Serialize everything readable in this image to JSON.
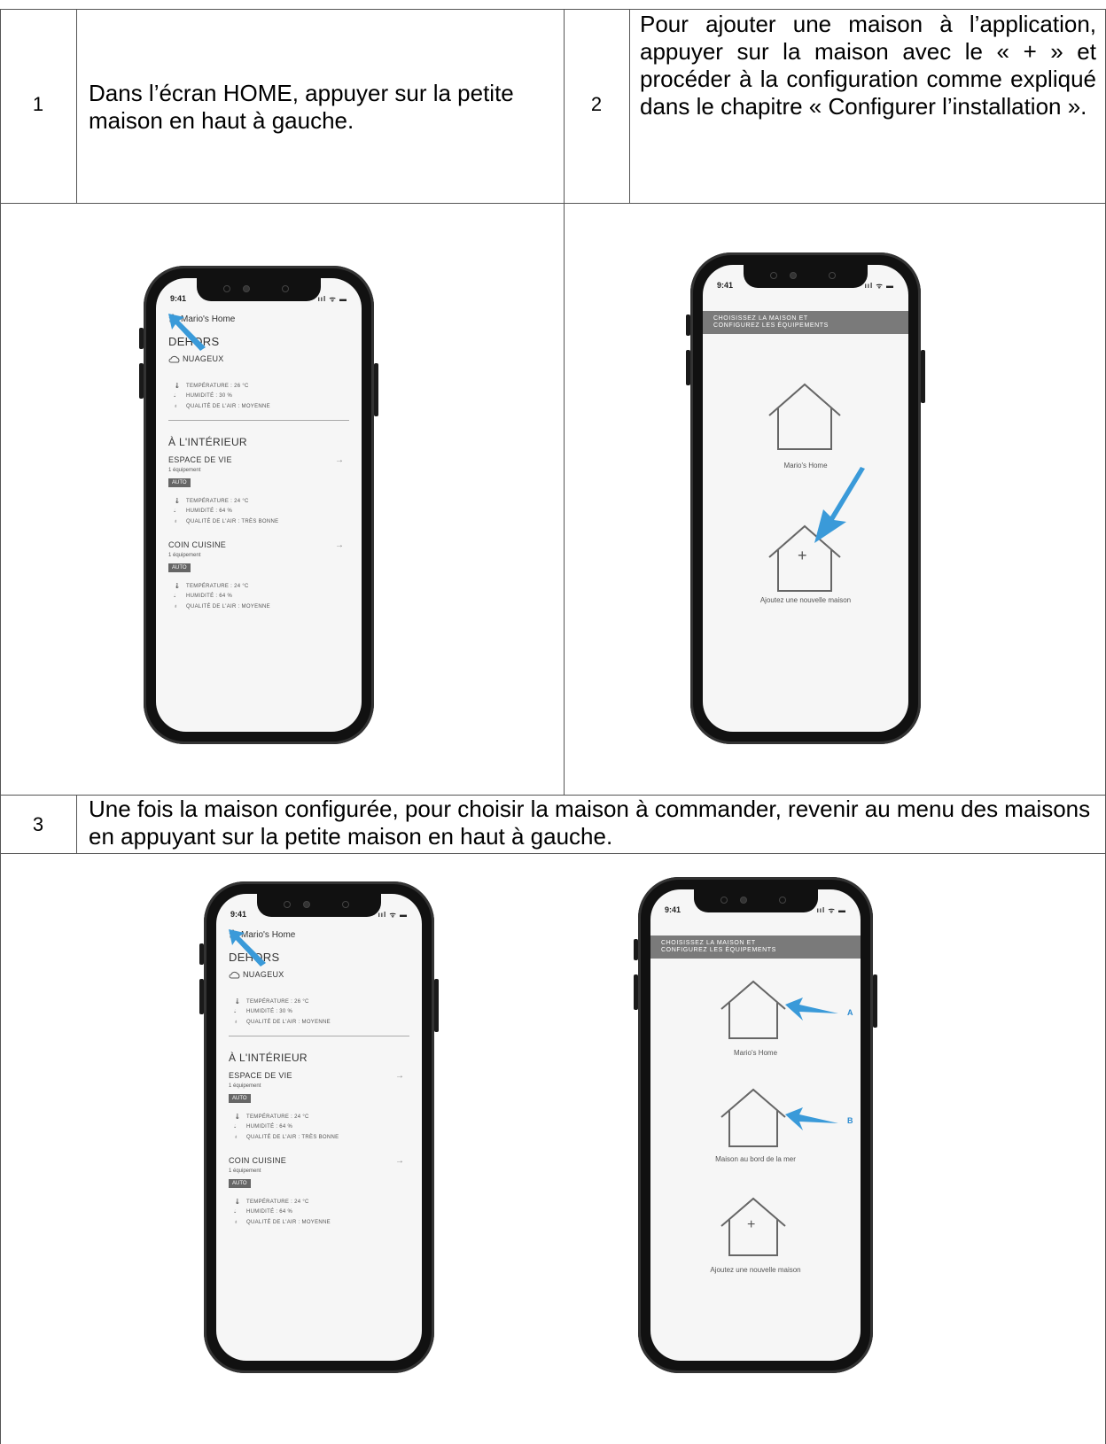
{
  "steps": [
    {
      "number": "1",
      "text": "Dans l’écran HOME, appuyer sur la petite maison en haut à gauche."
    },
    {
      "number": "2",
      "text": "Pour ajouter une maison à l’application, appuyer sur la maison avec le « + » et procéder à la configuration comme expliqué dans le chapitre « Configurer l’installation »."
    },
    {
      "number": "3",
      "text": "Une fois la maison configurée, pour choisir la maison à commander, revenir au menu des maisons en appuyant sur la petite maison en haut à gauche."
    }
  ],
  "phone_home": {
    "time": "9:41",
    "signal": "ııl ᯤ ▬",
    "home_name": "Mario's Home",
    "outdoor_title": "DEHORS",
    "weather": "NUAGEUX",
    "outdoor_rows": [
      "TEMPÉRATURE : 26 °C",
      "HUMIDITÉ : 30 %",
      "QUALITÉ DE L'AIR : MOYENNE"
    ],
    "indoor_title": "À L'INTÉRIEUR",
    "rooms": [
      {
        "name": "ESPACE DE VIE",
        "count": "1 équipement",
        "mode": "AUTO",
        "rows": [
          "TEMPÉRATURE : 24 °C",
          "HUMIDITÉ : 64 %",
          "QUALITÉ DE L'AIR : TRÈS BONNE"
        ]
      },
      {
        "name": "COIN CUISINE",
        "count": "1 équipement",
        "mode": "AUTO",
        "rows": [
          "TEMPÉRATURE : 24 °C",
          "HUMIDITÉ : 64 %",
          "QUALITÉ DE L'AIR : MOYENNE"
        ]
      }
    ],
    "room_arrow": "→"
  },
  "phone_select": {
    "time": "9:41",
    "signal": "ııl ᯤ ▬",
    "banner_line1": "CHOISISSEZ LA MAISON ET",
    "banner_line2": "CONFIGUREZ LES ÉQUIPEMENTS",
    "homes": [
      "Mario's Home",
      "Maison au bord de la mer"
    ],
    "add_label": "Ajoutez une nouvelle maison",
    "plus": "+",
    "markers": [
      "A",
      "B"
    ]
  },
  "accent_color": "#3a9ad9"
}
